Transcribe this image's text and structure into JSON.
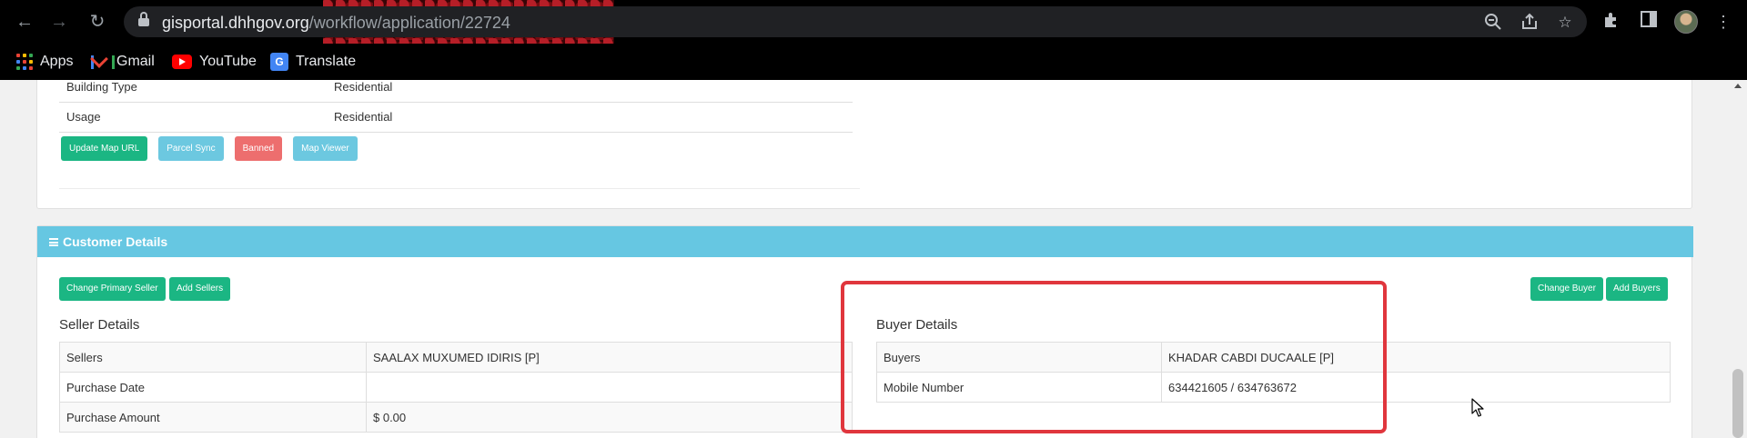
{
  "browser": {
    "url_host": "gisportal.dhhgov.org",
    "url_path": "/workflow/application/22724",
    "bookmarks": [
      {
        "label": "Apps"
      },
      {
        "label": "Gmail"
      },
      {
        "label": "YouTube"
      },
      {
        "label": "Translate"
      }
    ]
  },
  "property": {
    "rows": [
      {
        "key": "Building Type",
        "value": "Residential"
      },
      {
        "key": "Usage",
        "value": "Residential"
      }
    ],
    "buttons": {
      "update_map_url": "Update Map URL",
      "parcel_sync": "Parcel Sync",
      "banned": "Banned",
      "map_viewer": "Map Viewer"
    }
  },
  "customer": {
    "header": "Customer Details",
    "buttons": {
      "change_primary_seller": "Change Primary Seller",
      "add_sellers": "Add Sellers",
      "change_buyer": "Change Buyer",
      "add_buyers": "Add Buyers"
    },
    "seller": {
      "title": "Seller Details",
      "rows": [
        {
          "key": "Sellers",
          "value": "SAALAX MUXUMED IDIRIS [P]"
        },
        {
          "key": "Purchase Date",
          "value": ""
        },
        {
          "key": "Purchase Amount",
          "value": "$ 0.00"
        }
      ]
    },
    "buyer": {
      "title": "Buyer Details",
      "rows": [
        {
          "key": "Buyers",
          "value": "KHADAR CABDI DUCAALE [P]"
        },
        {
          "key": "Mobile Number",
          "value": "634421605 / 634763672"
        }
      ]
    }
  },
  "colors": {
    "accent_green": "#1bb683",
    "accent_teal": "#6cc8e0",
    "danger_red": "#ed6e6e",
    "header_blue": "#66c7e2",
    "highlight_red": "#e0363d"
  }
}
